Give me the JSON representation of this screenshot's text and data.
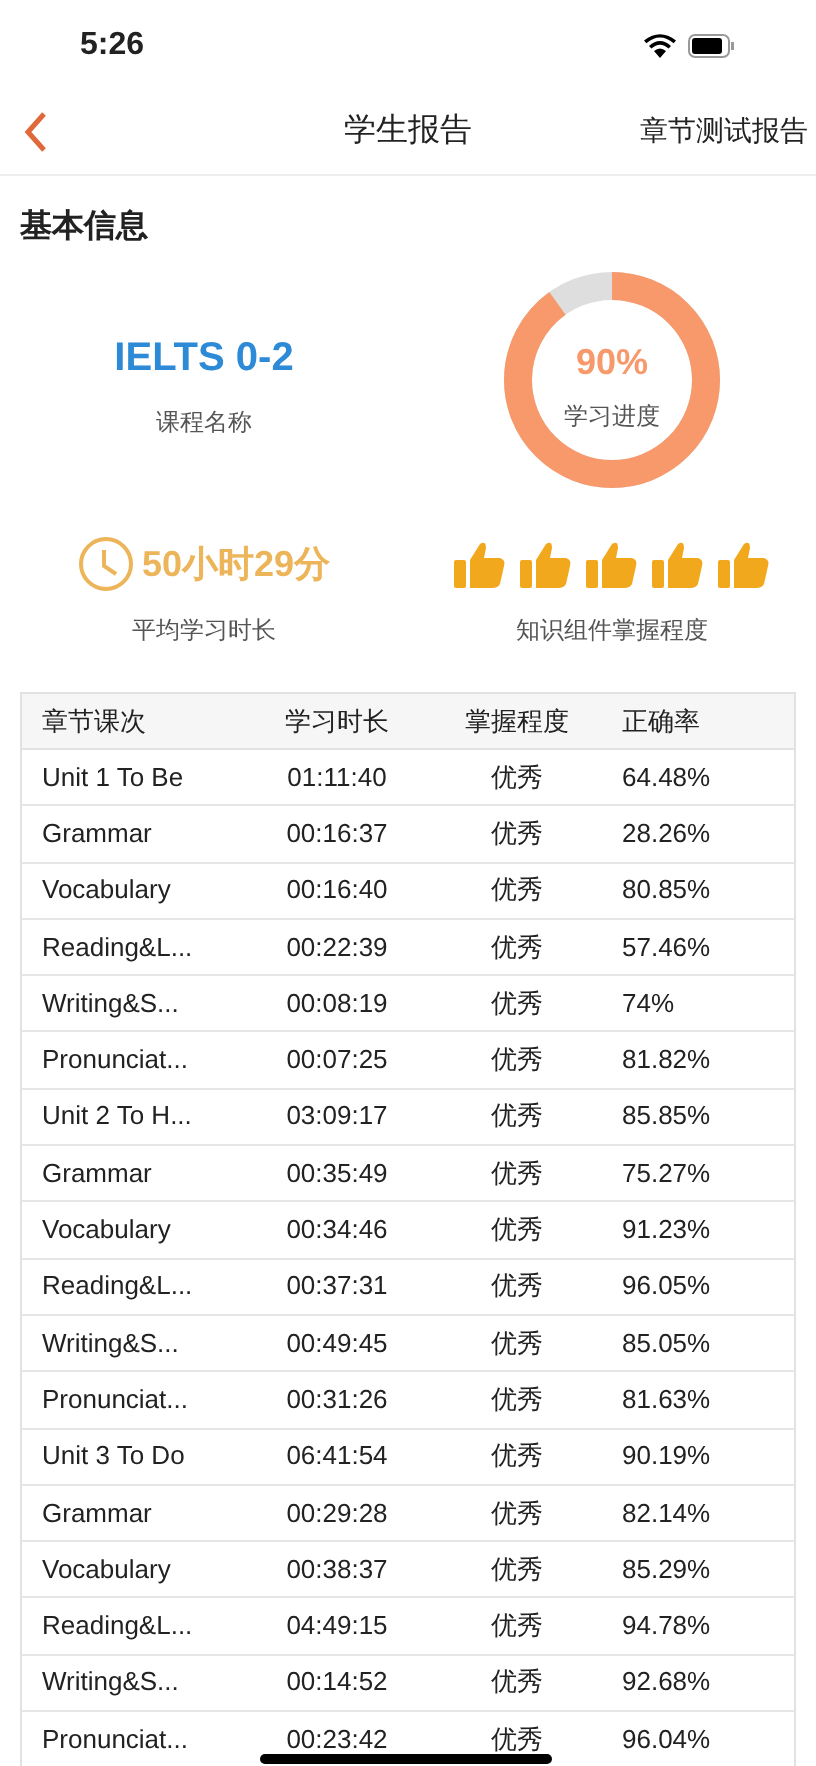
{
  "status_bar": {
    "time": "5:26"
  },
  "nav": {
    "title": "学生报告",
    "right_link": "章节测试报告"
  },
  "section_title": "基本信息",
  "course": {
    "value": "IELTS 0-2",
    "label": "课程名称"
  },
  "progress": {
    "value": "90%",
    "label": "学习进度",
    "level": 0.9
  },
  "study_time": {
    "value": "50小时29分",
    "label": "平均学习时长"
  },
  "mastery": {
    "stars": 5,
    "label": "知识组件掌握程度"
  },
  "table": {
    "columns": [
      "章节课次",
      "学习时长",
      "掌握程度",
      "正确率"
    ],
    "rows": [
      [
        "Unit 1 To Be",
        "01:11:40",
        "优秀",
        "64.48%"
      ],
      [
        "Grammar",
        "00:16:37",
        "优秀",
        "28.26%"
      ],
      [
        "Vocabulary",
        "00:16:40",
        "优秀",
        "80.85%"
      ],
      [
        "Reading&L...",
        "00:22:39",
        "优秀",
        "57.46%"
      ],
      [
        "Writing&S...",
        "00:08:19",
        "优秀",
        "74%"
      ],
      [
        "Pronunciat...",
        "00:07:25",
        "优秀",
        "81.82%"
      ],
      [
        "Unit 2 To H...",
        "03:09:17",
        "优秀",
        "85.85%"
      ],
      [
        "Grammar",
        "00:35:49",
        "优秀",
        "75.27%"
      ],
      [
        "Vocabulary",
        "00:34:46",
        "优秀",
        "91.23%"
      ],
      [
        "Reading&L...",
        "00:37:31",
        "优秀",
        "96.05%"
      ],
      [
        "Writing&S...",
        "00:49:45",
        "优秀",
        "85.05%"
      ],
      [
        "Pronunciat...",
        "00:31:26",
        "优秀",
        "81.63%"
      ],
      [
        "Unit 3 To Do",
        "06:41:54",
        "优秀",
        "90.19%"
      ],
      [
        "Grammar",
        "00:29:28",
        "优秀",
        "82.14%"
      ],
      [
        "Vocabulary",
        "00:38:37",
        "优秀",
        "85.29%"
      ],
      [
        "Reading&L...",
        "04:49:15",
        "优秀",
        "94.78%"
      ],
      [
        "Writing&S...",
        "00:14:52",
        "优秀",
        "92.68%"
      ],
      [
        "Pronunciat...",
        "00:23:42",
        "优秀",
        "96.04%"
      ]
    ]
  }
}
